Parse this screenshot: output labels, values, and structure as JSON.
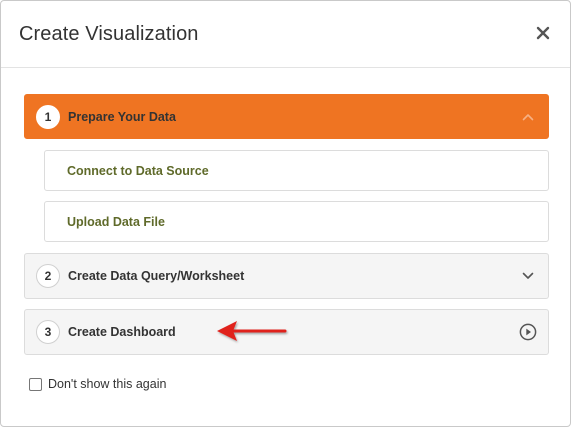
{
  "dialog": {
    "title": "Create Visualization",
    "close_icon": "close-icon"
  },
  "steps": [
    {
      "number": "1",
      "label": "Prepare Your Data",
      "state": "expanded",
      "icon": "chevron-up-icon"
    },
    {
      "number": "2",
      "label": "Create Data Query/Worksheet",
      "state": "collapsed",
      "icon": "chevron-down-icon"
    },
    {
      "number": "3",
      "label": "Create Dashboard",
      "state": "collapsed",
      "icon": "play-circle-icon"
    }
  ],
  "substeps": [
    {
      "label": "Connect to Data Source"
    },
    {
      "label": "Upload Data File"
    }
  ],
  "annotation": {
    "icon": "red-arrow-icon",
    "color": "#e0201b"
  },
  "footer": {
    "checkbox_label": "Don't show this again",
    "checked": false
  },
  "colors": {
    "accent": "#ef7422",
    "substep_text": "#5f6a2a",
    "step_bg": "#f5f5f5"
  }
}
